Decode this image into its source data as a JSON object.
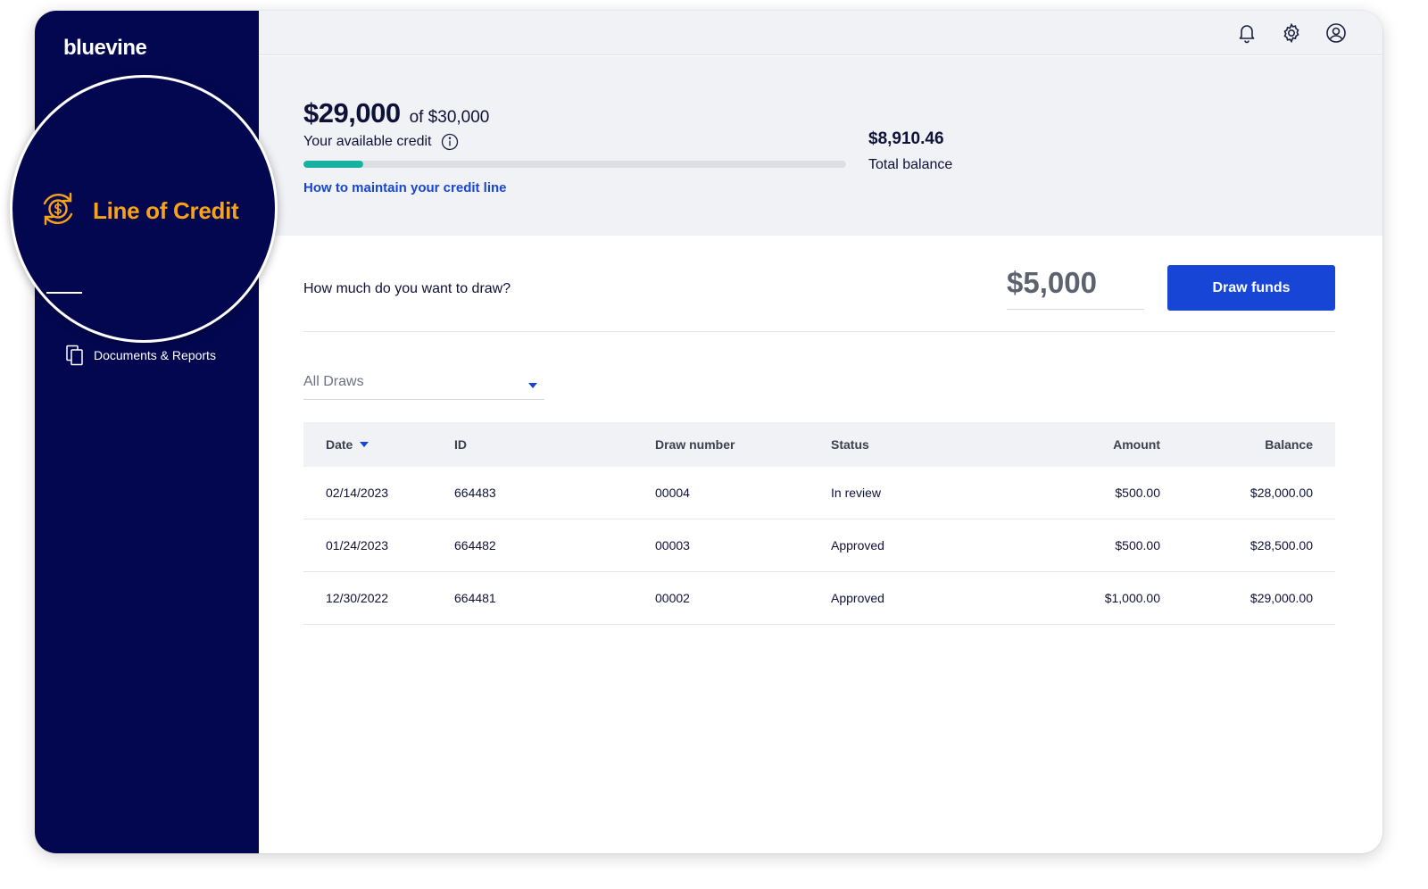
{
  "brand": {
    "name": "bluevine"
  },
  "sidebar": {
    "active_item": {
      "label": "Line of Credit",
      "icon": "dollar-refresh-icon"
    },
    "items": [
      {
        "label": "Documents & Reports",
        "icon": "documents-icon"
      }
    ]
  },
  "topbar": {
    "icons": [
      "bell-icon",
      "gear-icon",
      "user-icon"
    ]
  },
  "summary": {
    "available_credit": "$29,000",
    "credit_limit": "of $30,000",
    "available_label": "Your available credit",
    "progress_fraction": 0.11,
    "maintain_link": "How to maintain your credit line",
    "total_balance": "$8,910.46",
    "total_balance_label": "Total balance"
  },
  "draw": {
    "question": "How much do you want to draw?",
    "amount": "$5,000",
    "button_label": "Draw funds"
  },
  "filter": {
    "selected": "All Draws"
  },
  "table": {
    "headers": {
      "date": "Date",
      "id": "ID",
      "draw_number": "Draw number",
      "status": "Status",
      "amount": "Amount",
      "balance": "Balance"
    },
    "rows": [
      {
        "date": "02/14/2023",
        "id": "664483",
        "draw_number": "00004",
        "status": "In review",
        "amount": "$500.00",
        "balance": "$28,000.00"
      },
      {
        "date": "01/24/2023",
        "id": "664482",
        "draw_number": "00003",
        "status": "Approved",
        "amount": "$500.00",
        "balance": "$28,500.00"
      },
      {
        "date": "12/30/2022",
        "id": "664481",
        "draw_number": "00002",
        "status": "Approved",
        "amount": "$1,000.00",
        "balance": "$29,000.00"
      }
    ]
  },
  "colors": {
    "sidebar_bg": "#030750",
    "accent_blue": "#1746d6",
    "accent_orange": "#f6a21a",
    "progress_teal": "#19b2a0",
    "summary_bg": "#f1f2f6"
  }
}
